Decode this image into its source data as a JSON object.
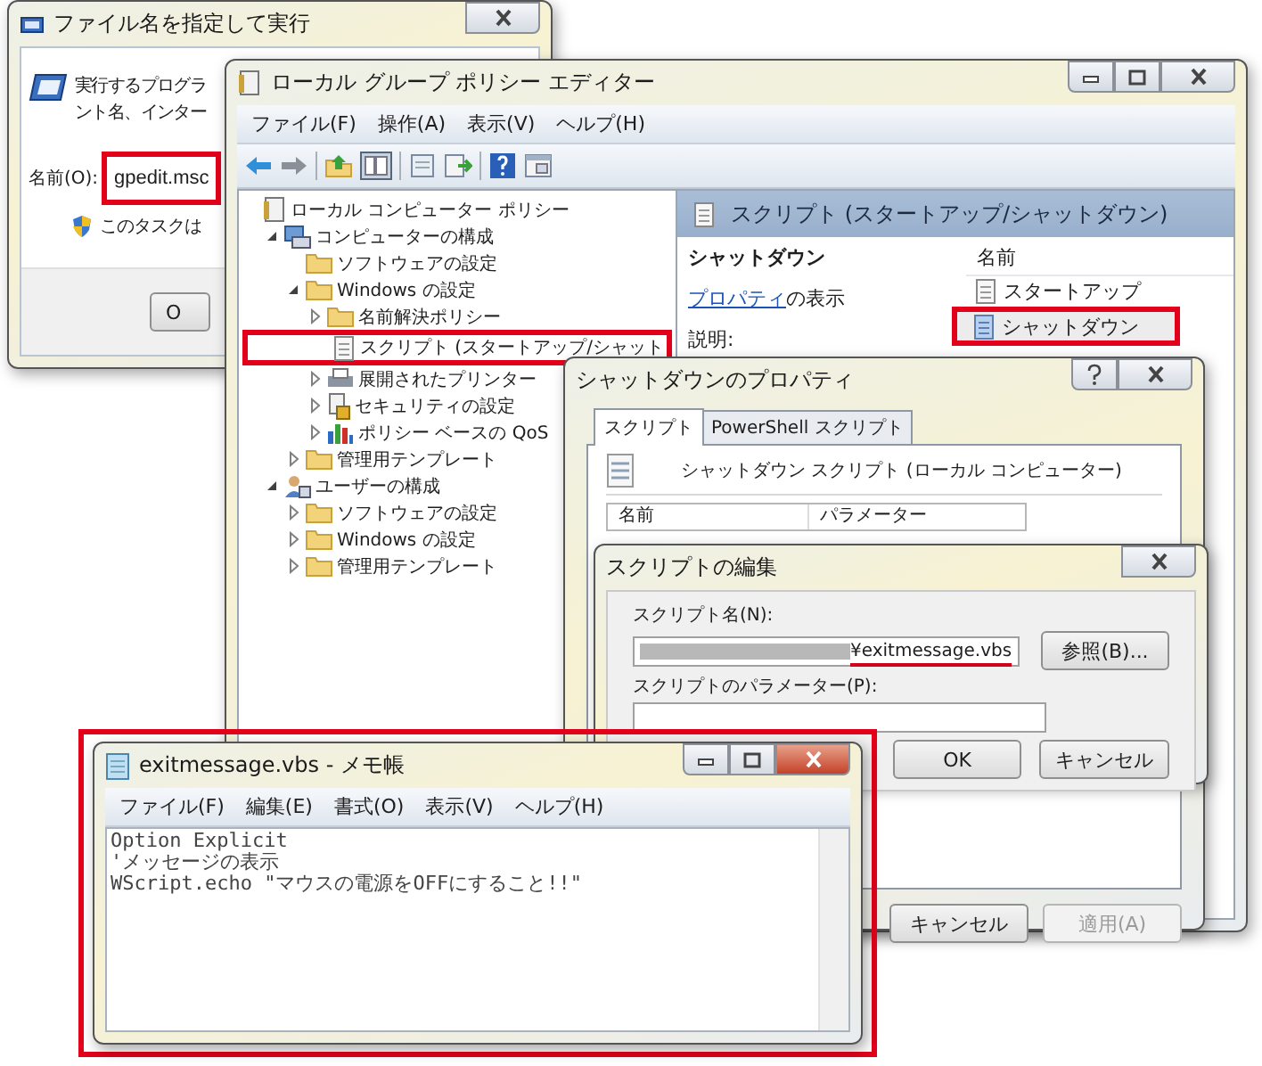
{
  "run_dialog": {
    "title": "ファイル名を指定して実行",
    "description_lines": [
      "実行するプログラ",
      "ント名、インター"
    ],
    "name_label": "名前(O):",
    "name_field": {
      "value": "gpedit.msc",
      "highlighted": true
    },
    "admin_note": "このタスクは",
    "button": "O"
  },
  "policy_editor": {
    "title": "ローカル グループ ポリシー エディター",
    "menu": [
      "ファイル(F)",
      "操作(A)",
      "表示(V)",
      "ヘルプ(H)"
    ],
    "tree": [
      {
        "label": "ローカル コンピューター ポリシー",
        "kind": "policy",
        "children": [
          {
            "label": "コンピューターの構成",
            "kind": "computer",
            "expanded": true,
            "children": [
              {
                "label": "ソフトウェアの設定",
                "kind": "folder"
              },
              {
                "label": "Windows の設定",
                "kind": "folder",
                "expanded": true,
                "children": [
                  {
                    "label": "名前解決ポリシー",
                    "kind": "folder",
                    "expanded": false
                  },
                  {
                    "label": "スクリプト (スタートアップ/シャット",
                    "kind": "script",
                    "highlighted": true
                  },
                  {
                    "label": "展開されたプリンター",
                    "kind": "printer",
                    "expanded": false
                  },
                  {
                    "label": "セキュリティの設定",
                    "kind": "security",
                    "expanded": false
                  },
                  {
                    "label": "ポリシー ベースの QoS",
                    "kind": "chart",
                    "expanded": false
                  }
                ]
              },
              {
                "label": "管理用テンプレート",
                "kind": "folder",
                "expanded": false
              }
            ]
          },
          {
            "label": "ユーザーの構成",
            "kind": "user",
            "expanded": true,
            "children": [
              {
                "label": "ソフトウェアの設定",
                "kind": "folder",
                "expanded": false
              },
              {
                "label": "Windows の設定",
                "kind": "folder",
                "expanded": false
              },
              {
                "label": "管理用テンプレート",
                "kind": "folder",
                "expanded": false
              }
            ]
          }
        ]
      }
    ],
    "detail": {
      "header": "スクリプト (スタートアップ/シャットダウン)",
      "heading": "シャットダウン",
      "link": "プロパティ",
      "link_suffix": "の表示",
      "description_label": "説明:",
      "list_column": "名前",
      "items": [
        {
          "label": "スタートアップ",
          "selected": false,
          "highlighted": false
        },
        {
          "label": "シャットダウン",
          "selected": true,
          "highlighted": true
        }
      ]
    }
  },
  "properties_dialog": {
    "title": "シャットダウンのプロパティ",
    "tabs": [
      {
        "label": "スクリプト",
        "selected": true
      },
      {
        "label": "PowerShell スクリプト",
        "selected": false
      }
    ],
    "heading": "シャットダウン スクリプト (ローカル コンピューター)",
    "columns": [
      "名前",
      "パラメーター"
    ],
    "buttons": [
      {
        "label": "キャンセル",
        "disabled": false
      },
      {
        "label": "適用(A)",
        "disabled": true
      }
    ]
  },
  "edit_dialog": {
    "title": "スクリプトの編集",
    "script_name_label": "スクリプト名(N):",
    "script_name": {
      "value": "¥exitmessage.vbs",
      "underlined": true
    },
    "browse_button": "参照(B)...",
    "parameters_label": "スクリプトのパラメーター(P):",
    "buttons": [
      "OK",
      "キャンセル"
    ]
  },
  "notepad": {
    "title": "exitmessage.vbs - メモ帳",
    "highlighted": true,
    "menu": [
      "ファイル(F)",
      "編集(E)",
      "書式(O)",
      "表示(V)",
      "ヘルプ(H)"
    ],
    "lines": [
      "Option Explicit",
      "'メッセージの表示",
      "WScript.echo \"マウスの電源をOFFにすること!!\""
    ]
  }
}
